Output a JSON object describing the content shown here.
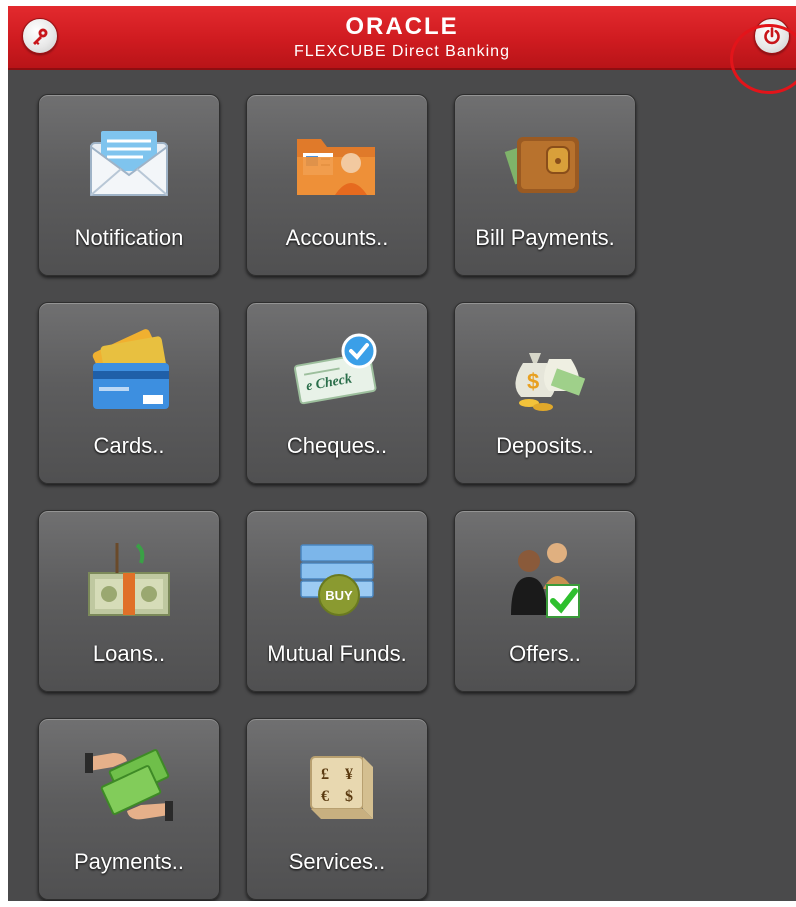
{
  "header": {
    "brand": "ORACLE",
    "product": "FLEXCUBE Direct Banking",
    "key_icon": "key-icon",
    "power_icon": "power-icon",
    "accent_color": "#cf1b20",
    "highlight_color": "#e3141a"
  },
  "tiles": [
    {
      "label": "Notification",
      "icon": "envelope-icon"
    },
    {
      "label": "Accounts..",
      "icon": "folder-user-icon"
    },
    {
      "label": "Bill Payments.",
      "icon": "wallet-icon"
    },
    {
      "label": "Cards..",
      "icon": "credit-cards-icon"
    },
    {
      "label": "Cheques..",
      "icon": "echeck-icon"
    },
    {
      "label": "Deposits..",
      "icon": "money-bags-icon"
    },
    {
      "label": "Loans..",
      "icon": "cash-stack-icon"
    },
    {
      "label": "Mutual Funds.",
      "icon": "buy-icon"
    },
    {
      "label": "Offers..",
      "icon": "people-check-icon"
    },
    {
      "label": "Payments..",
      "icon": "money-handover-icon"
    },
    {
      "label": "Services..",
      "icon": "currency-block-icon"
    }
  ],
  "buy_text": "BUY",
  "check_text": "e Check"
}
